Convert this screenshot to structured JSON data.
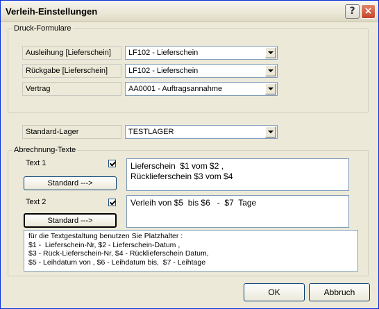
{
  "window": {
    "title": "Verleih-Einstellungen",
    "help_glyph": "?",
    "close_glyph": "×"
  },
  "druck": {
    "legend": "Druck-Formulare",
    "rows": [
      {
        "label": "Ausleihung [Lieferschein]",
        "value": "LF102 - Lieferschein"
      },
      {
        "label": "Rückgabe [Lieferschein]",
        "value": "LF102 - Lieferschein"
      },
      {
        "label": "Vertrag",
        "value": "AA0001 - Auftragsannahme"
      }
    ]
  },
  "lager": {
    "label": "Standard-Lager",
    "value": "TESTLAGER"
  },
  "abrechnung": {
    "legend": "Abrechnung-Texte",
    "text1": {
      "label": "Text 1",
      "checked": true,
      "button": "Standard --->",
      "lines": [
        "Lieferschein  $1 vom $2 ,",
        "Rücklieferschein $3 vom $4"
      ]
    },
    "text2": {
      "label": "Text 2",
      "checked": true,
      "button": "Standard --->",
      "lines": [
        "Verleih von $5  bis $6   -  $7  Tage"
      ]
    },
    "info_lines": [
      "für die Textgestaltung benutzen Sie Platzhalter :",
      "$1 -  Lieferschein-Nr, $2 - Lieferschein-Datum ,",
      "$3 - Rück-Lieferschein-Nr, $4 - Rücklieferschein Datum,",
      "$5 - Leihdatum von , $6 - Leihdatum bis,  $7 - Leihtage"
    ]
  },
  "buttons": {
    "ok": "OK",
    "cancel": "Abbruch"
  },
  "colors": {
    "dialog_bg": "#ece9d8",
    "frame_border": "#0831d9",
    "field_border": "#7f9db9",
    "close_button": "#c6432a"
  },
  "icons": {
    "help": "question-mark-icon",
    "close": "close-x-icon",
    "dropdown": "chevron-down-icon",
    "check": "checkmark-icon"
  }
}
